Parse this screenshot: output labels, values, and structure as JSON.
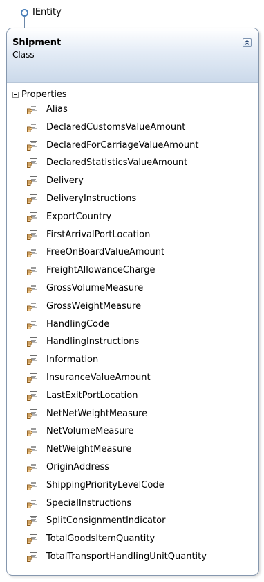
{
  "interface": {
    "name": "IEntity",
    "icon": "interface-lollipop-icon"
  },
  "class": {
    "name": "Shipment",
    "kind": "Class",
    "collapse_icon": "collapse-chevrons-icon",
    "properties_title": "Properties",
    "property_icon": "property-hand-icon",
    "properties": [
      "Alias",
      "DeclaredCustomsValueAmount",
      "DeclaredForCarriageValueAmount",
      "DeclaredStatisticsValueAmount",
      "Delivery",
      "DeliveryInstructions",
      "ExportCountry",
      "FirstArrivalPortLocation",
      "FreeOnBoardValueAmount",
      "FreightAllowanceCharge",
      "GrossVolumeMeasure",
      "GrossWeightMeasure",
      "HandlingCode",
      "HandlingInstructions",
      "Information",
      "InsuranceValueAmount",
      "LastExitPortLocation",
      "NetNetWeightMeasure",
      "NetVolumeMeasure",
      "NetWeightMeasure",
      "OriginAddress",
      "ShippingPriorityLevelCode",
      "SpecialInstructions",
      "SplitConsignmentIndicator",
      "TotalGoodsItemQuantity",
      "TotalTransportHandlingUnitQuantity"
    ]
  },
  "colors": {
    "border": "#8597ae",
    "header_top": "#ffffff",
    "header_bottom": "#cbd9ea",
    "interface_ring": "#4a7fb8"
  }
}
